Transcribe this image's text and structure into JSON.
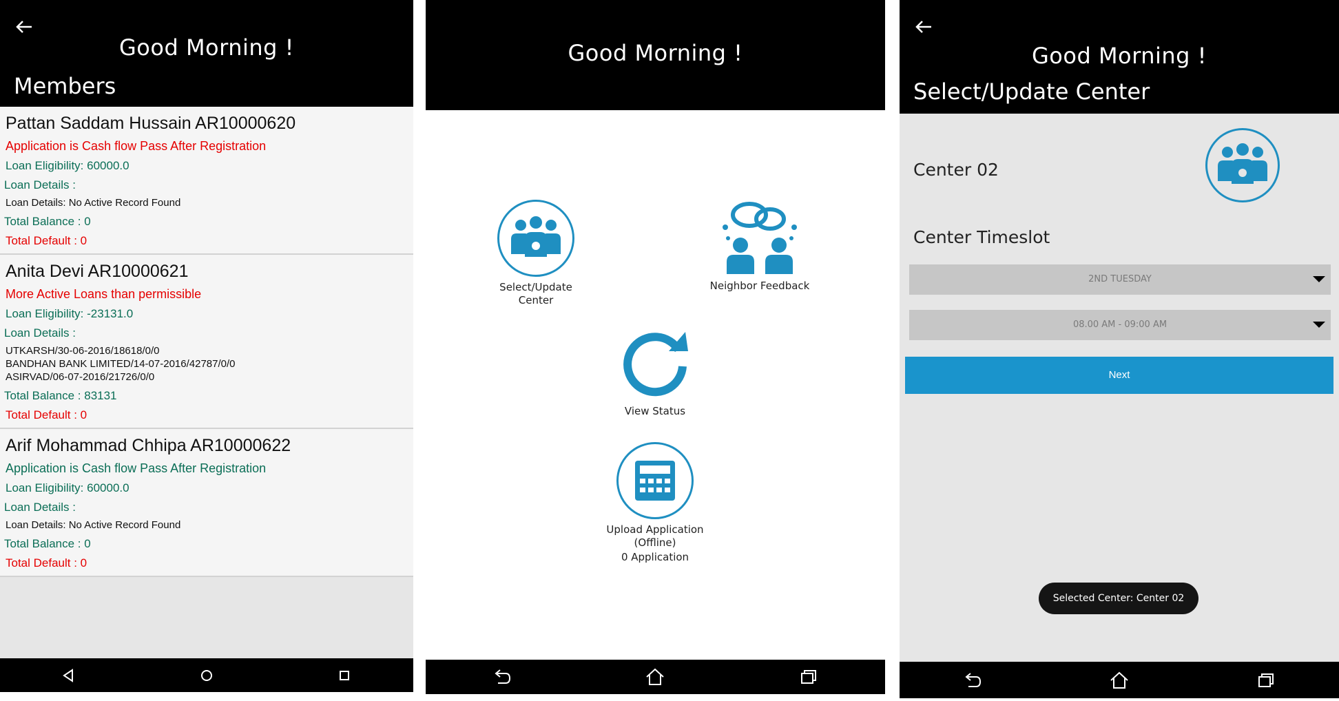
{
  "screen1": {
    "greeting": "Good Morning !",
    "title": "Members",
    "members": [
      {
        "name": "Pattan Saddam Hussain AR10000620",
        "status": "Application is Cash flow Pass After Registration",
        "status_color": "#e50000",
        "eligibility": "Loan Eligibility: 60000.0",
        "details_label": "Loan Details :",
        "details": [
          "Loan Details: No Active Record Found"
        ],
        "balance": "Total Balance : 0",
        "default": "Total Default : 0"
      },
      {
        "name": "Anita Devi AR10000621",
        "status": "More Active Loans than permissible",
        "status_color": "#e50000",
        "eligibility": "Loan Eligibility: -23131.0",
        "details_label": "Loan Details :",
        "details": [
          "UTKARSH/30-06-2016/18618/0/0",
          "BANDHAN BANK LIMITED/14-07-2016/42787/0/0",
          "ASIRVAD/06-07-2016/21726/0/0"
        ],
        "balance": "Total Balance : 83131",
        "default": "Total Default : 0"
      },
      {
        "name": "Arif Mohammad Chhipa AR10000622",
        "status": "Application is Cash flow Pass After Registration",
        "status_color": "#0b6e56",
        "eligibility": "Loan Eligibility: 60000.0",
        "details_label": "Loan Details :",
        "details": [
          "Loan Details: No Active Record Found"
        ],
        "balance": "Total Balance : 0",
        "default": "Total Default : 0"
      }
    ]
  },
  "screen2": {
    "greeting": "Good Morning !",
    "menu": {
      "select_center": [
        "Select/Update",
        "Center"
      ],
      "neighbor_feedback": "Neighbor Feedback",
      "view_status": "View Status",
      "upload": [
        "Upload Application",
        "(Offline)",
        "0 Application"
      ]
    }
  },
  "screen3": {
    "greeting": "Good Morning !",
    "title": "Select/Update Center",
    "center_name": "Center 02",
    "timeslot_label": "Center Timeslot",
    "day_value": "2ND TUESDAY",
    "time_value": "08.00 AM - 09:00 AM",
    "next_label": "Next",
    "toast": "Selected Center: Center 02"
  },
  "icons": {
    "back": "back-arrow-icon",
    "accent_color": "#1f8fc1"
  }
}
